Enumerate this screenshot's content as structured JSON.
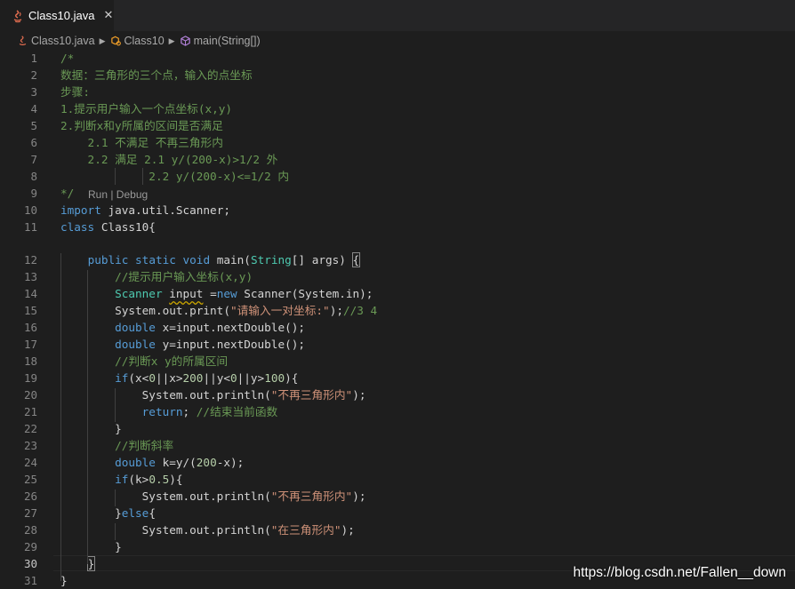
{
  "tab": {
    "filename": "Class10.java",
    "close_glyph": "✕",
    "file_icon": "java-icon"
  },
  "breadcrumb": {
    "file": "Class10.java",
    "class": "Class10",
    "method": "main(String[])"
  },
  "codelens": "Run | Debug",
  "editor": {
    "active_line": 30,
    "line_numbers": [
      "1",
      "2",
      "3",
      "4",
      "5",
      "6",
      "7",
      "8",
      "9",
      "10",
      "11",
      "12",
      "13",
      "14",
      "15",
      "16",
      "17",
      "18",
      "19",
      "20",
      "21",
      "22",
      "23",
      "24",
      "25",
      "26",
      "27",
      "28",
      "29",
      "30",
      "31"
    ],
    "lines": [
      [
        {
          "t": "/*",
          "c": "cm"
        }
      ],
      [
        {
          "t": "数据：三角形的三个点，输入的点坐标",
          "c": "cm"
        }
      ],
      [
        {
          "t": "步骤:",
          "c": "cm"
        }
      ],
      [
        {
          "t": "1.提示用户输入一个点坐标(x,y)",
          "c": "cm"
        }
      ],
      [
        {
          "t": "2.判断x和y所属的区间是否满足",
          "c": "cm"
        }
      ],
      [
        {
          "t": "    2.1 不满足 不再三角形内",
          "c": "cm"
        }
      ],
      [
        {
          "t": "    2.2 满足 2.1 y/(200-x)>1/2 外",
          "c": "cm"
        }
      ],
      [
        {
          "t": "             2.2 y/(200-x)<=1/2 内",
          "c": "cm"
        }
      ],
      [
        {
          "t": "*/",
          "c": "cm"
        }
      ],
      [
        {
          "t": "import",
          "c": "kw"
        },
        {
          "t": " java.util.Scanner;",
          "c": "tx"
        }
      ],
      [
        {
          "t": "class",
          "c": "kw"
        },
        {
          "t": " Class10{",
          "c": "tx"
        }
      ],
      [
        {
          "t": "    ",
          "c": "tx"
        },
        {
          "t": "public",
          "c": "kw"
        },
        {
          "t": " ",
          "c": "tx"
        },
        {
          "t": "static",
          "c": "kw"
        },
        {
          "t": " ",
          "c": "tx"
        },
        {
          "t": "void",
          "c": "kw"
        },
        {
          "t": " main(",
          "c": "tx"
        },
        {
          "t": "String",
          "c": "ty"
        },
        {
          "t": "[] args) ",
          "c": "tx"
        },
        {
          "t": "{",
          "c": "tx",
          "box": true
        }
      ],
      [
        {
          "t": "        //提示用户输入坐标(x,y)",
          "c": "cm"
        }
      ],
      [
        {
          "t": "        ",
          "c": "tx"
        },
        {
          "t": "Scanner",
          "c": "ty"
        },
        {
          "t": " ",
          "c": "tx"
        },
        {
          "t": "input",
          "c": "tx",
          "squig": true
        },
        {
          "t": " =",
          "c": "tx"
        },
        {
          "t": "new",
          "c": "kw"
        },
        {
          "t": " Scanner(System.in);",
          "c": "tx"
        }
      ],
      [
        {
          "t": "        System.out.print(",
          "c": "tx"
        },
        {
          "t": "\"请输入一对坐标:\"",
          "c": "st"
        },
        {
          "t": ");",
          "c": "tx"
        },
        {
          "t": "//3 4",
          "c": "cm"
        }
      ],
      [
        {
          "t": "        ",
          "c": "tx"
        },
        {
          "t": "double",
          "c": "kw"
        },
        {
          "t": " x=input.nextDouble();",
          "c": "tx"
        }
      ],
      [
        {
          "t": "        ",
          "c": "tx"
        },
        {
          "t": "double",
          "c": "kw"
        },
        {
          "t": " y=input.nextDouble();",
          "c": "tx"
        }
      ],
      [
        {
          "t": "        //判断x y的所属区间",
          "c": "cm"
        }
      ],
      [
        {
          "t": "        ",
          "c": "tx"
        },
        {
          "t": "if",
          "c": "kw"
        },
        {
          "t": "(x<",
          "c": "tx"
        },
        {
          "t": "0",
          "c": "nu"
        },
        {
          "t": "||x>",
          "c": "tx"
        },
        {
          "t": "200",
          "c": "nu"
        },
        {
          "t": "||y<",
          "c": "tx"
        },
        {
          "t": "0",
          "c": "nu"
        },
        {
          "t": "||y>",
          "c": "tx"
        },
        {
          "t": "100",
          "c": "nu"
        },
        {
          "t": "){",
          "c": "tx"
        }
      ],
      [
        {
          "t": "            System.out.println(",
          "c": "tx"
        },
        {
          "t": "\"不再三角形内\"",
          "c": "st"
        },
        {
          "t": ");",
          "c": "tx"
        }
      ],
      [
        {
          "t": "            ",
          "c": "tx"
        },
        {
          "t": "return",
          "c": "kw"
        },
        {
          "t": "; ",
          "c": "tx"
        },
        {
          "t": "//结束当前函数",
          "c": "cm"
        }
      ],
      [
        {
          "t": "        }",
          "c": "tx"
        }
      ],
      [
        {
          "t": "        //判断斜率",
          "c": "cm"
        }
      ],
      [
        {
          "t": "        ",
          "c": "tx"
        },
        {
          "t": "double",
          "c": "kw"
        },
        {
          "t": " k=y/(",
          "c": "tx"
        },
        {
          "t": "200",
          "c": "nu"
        },
        {
          "t": "-x);",
          "c": "tx"
        }
      ],
      [
        {
          "t": "        ",
          "c": "tx"
        },
        {
          "t": "if",
          "c": "kw"
        },
        {
          "t": "(k>",
          "c": "tx"
        },
        {
          "t": "0.5",
          "c": "nu"
        },
        {
          "t": "){",
          "c": "tx"
        }
      ],
      [
        {
          "t": "            System.out.println(",
          "c": "tx"
        },
        {
          "t": "\"不再三角形内\"",
          "c": "st"
        },
        {
          "t": ");",
          "c": "tx"
        }
      ],
      [
        {
          "t": "        }",
          "c": "tx"
        },
        {
          "t": "else",
          "c": "kw"
        },
        {
          "t": "{",
          "c": "tx"
        }
      ],
      [
        {
          "t": "            System.out.println(",
          "c": "tx"
        },
        {
          "t": "\"在三角形内\"",
          "c": "st"
        },
        {
          "t": ");",
          "c": "tx"
        }
      ],
      [
        {
          "t": "        }",
          "c": "tx"
        }
      ],
      [
        {
          "t": "    ",
          "c": "tx"
        },
        {
          "t": "}",
          "c": "tx",
          "box": true
        }
      ],
      [
        {
          "t": "}",
          "c": "tx"
        }
      ]
    ]
  },
  "watermark": "https://blog.csdn.net/Fallen__down",
  "colors": {
    "background": "#1e1e1e",
    "comment": "#6a9955",
    "keyword": "#569cd6",
    "type": "#4ec9b0",
    "string": "#ce9178",
    "number": "#b5cea8"
  }
}
